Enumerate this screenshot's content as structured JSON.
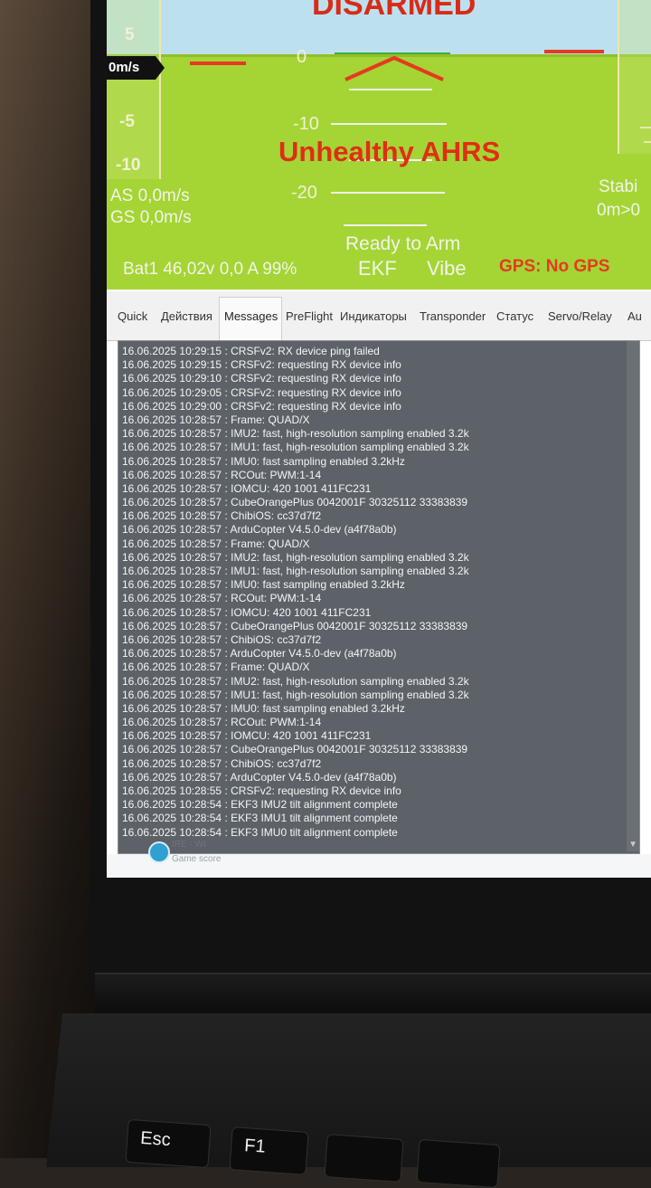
{
  "hud": {
    "status_disarmed": "DISARMED",
    "status_ahrs": "Unhealthy AHRS",
    "speed_readout": "0m/s",
    "speed_ticks": [
      "5",
      "-5",
      "-10"
    ],
    "pitch_labels": [
      "0",
      "-10",
      "-20"
    ],
    "airspeed": "AS 0,0m/s",
    "groundspeed": "GS 0,0m/s",
    "ready": "Ready to Arm",
    "battery": "Bat1 46,02v 0,0 A 99%",
    "ekf": "EKF",
    "vibe": "Vibe",
    "gps": "GPS: No GPS",
    "mode": "Stabi",
    "vertical_speed": "0m>0",
    "colors": {
      "ground": "#a4d534",
      "sky": "#bde0ee",
      "warning": "#e02e16"
    }
  },
  "tabs": [
    {
      "label": "Quick"
    },
    {
      "label": "Действия"
    },
    {
      "label": "Messages"
    },
    {
      "label": "PreFlight"
    },
    {
      "label": "Индикаторы"
    },
    {
      "label": "Transponder"
    },
    {
      "label": "Статус"
    },
    {
      "label": "Servo/Relay"
    },
    {
      "label": "Au"
    }
  ],
  "messages": [
    "16.06.2025 10:29:15 : CRSFv2: RX device ping failed",
    "16.06.2025 10:29:15 : CRSFv2: requesting RX device info",
    "16.06.2025 10:29:10 : CRSFv2: requesting RX device info",
    "16.06.2025 10:29:05 : CRSFv2: requesting RX device info",
    "16.06.2025 10:29:00 : CRSFv2: requesting RX device info",
    "16.06.2025 10:28:57 : Frame: QUAD/X",
    "16.06.2025 10:28:57 : IMU2: fast, high-resolution sampling enabled 3.2k",
    "16.06.2025 10:28:57 : IMU1: fast, high-resolution sampling enabled 3.2k",
    "16.06.2025 10:28:57 : IMU0: fast sampling enabled 3.2kHz",
    "16.06.2025 10:28:57 : RCOut: PWM:1-14",
    "16.06.2025 10:28:57 : IOMCU: 420 1001 411FC231",
    "16.06.2025 10:28:57 : CubeOrangePlus 0042001F 30325112 33383839",
    "16.06.2025 10:28:57 : ChibiOS: cc37d7f2",
    "16.06.2025 10:28:57 : ArduCopter V4.5.0-dev (a4f78a0b)",
    "16.06.2025 10:28:57 : Frame: QUAD/X",
    "16.06.2025 10:28:57 : IMU2: fast, high-resolution sampling enabled 3.2k",
    "16.06.2025 10:28:57 : IMU1: fast, high-resolution sampling enabled 3.2k",
    "16.06.2025 10:28:57 : IMU0: fast sampling enabled 3.2kHz",
    "16.06.2025 10:28:57 : RCOut: PWM:1-14",
    "16.06.2025 10:28:57 : IOMCU: 420 1001 411FC231",
    "16.06.2025 10:28:57 : CubeOrangePlus 0042001F 30325112 33383839",
    "16.06.2025 10:28:57 : ChibiOS: cc37d7f2",
    "16.06.2025 10:28:57 : ArduCopter V4.5.0-dev (a4f78a0b)",
    "16.06.2025 10:28:57 : Frame: QUAD/X",
    "16.06.2025 10:28:57 : IMU2: fast, high-resolution sampling enabled 3.2k",
    "16.06.2025 10:28:57 : IMU1: fast, high-resolution sampling enabled 3.2k",
    "16.06.2025 10:28:57 : IMU0: fast sampling enabled 3.2kHz",
    "16.06.2025 10:28:57 : RCOut: PWM:1-14",
    "16.06.2025 10:28:57 : IOMCU: 420 1001 411FC231",
    "16.06.2025 10:28:57 : CubeOrangePlus 0042001F 30325112 33383839",
    "16.06.2025 10:28:57 : ChibiOS: cc37d7f2",
    "16.06.2025 10:28:57 : ArduCopter V4.5.0-dev (a4f78a0b)",
    "16.06.2025 10:28:55 : CRSFv2: requesting RX device info",
    "16.06.2025 10:28:54 : EKF3 IMU2 tilt alignment complete",
    "16.06.2025 10:28:54 : EKF3 IMU1 tilt alignment complete",
    "16.06.2025 10:28:54 : EKF3 IMU0 tilt alignment complete"
  ],
  "notification": {
    "title": "IRE - WI",
    "subtitle": "Game score"
  },
  "keyboard": {
    "esc": "Esc",
    "f1": "F1",
    "f2": "",
    "f3": ""
  }
}
